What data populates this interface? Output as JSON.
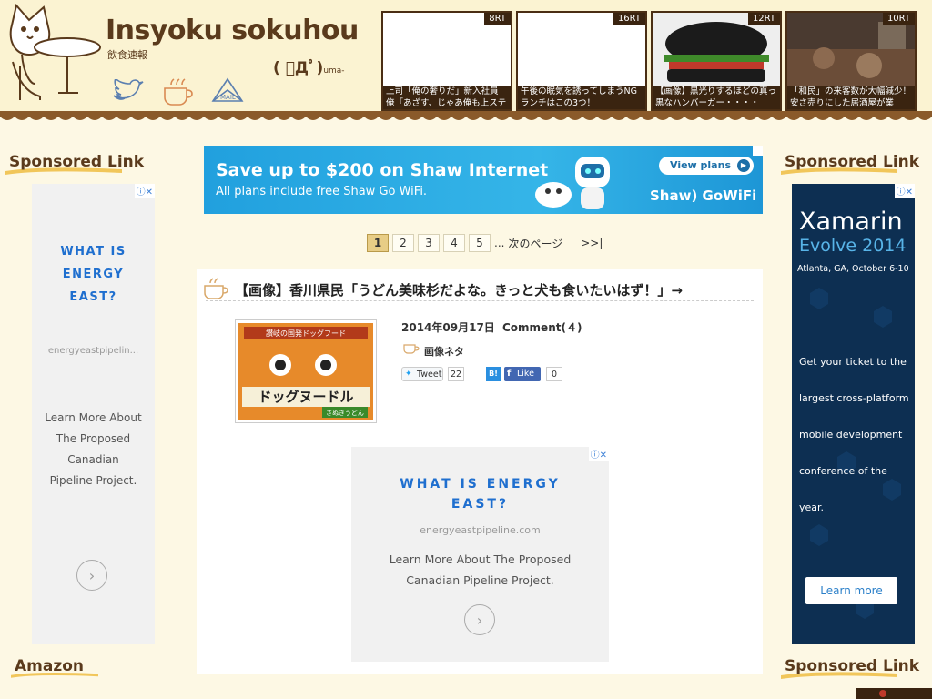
{
  "site": {
    "title": "Insyoku sokuhou",
    "subtitle": "飲食速報",
    "face": "( ﾟДﾟ)",
    "face_suffix": "uma-"
  },
  "social": [
    {
      "name": "twitter-icon"
    },
    {
      "name": "rss-icon"
    },
    {
      "name": "mail-icon"
    }
  ],
  "rt_items": [
    {
      "badge": "8RT",
      "caption": "上司「俺の奢りだ」新入社員 俺「あざす、じゃあ俺も上ステ"
    },
    {
      "badge": "16RT",
      "caption": "午後の眠気を誘ってしまうNG ランチはこの3つ！"
    },
    {
      "badge": "12RT",
      "caption": "【画像】黒光りするほどの真っ 黒なハンバーガー・・・・"
    },
    {
      "badge": "10RT",
      "caption": "「和民」の来客数が大幅減少！ 安さ売りにした居酒屋が業"
    }
  ],
  "left_sidebar": {
    "title": "Sponsored Link",
    "bottom_title": "Amazon",
    "ad": {
      "headline": "WHAT IS ENERGY EAST?",
      "url": "energyeastpipelin...",
      "body": "Learn More About The Proposed Canadian Pipeline Project."
    }
  },
  "right_sidebar": {
    "title": "Sponsored Link",
    "bottom_title": "Sponsored Link",
    "ad": {
      "brand": "Xamarin",
      "event": "Evolve 2014",
      "location": "Atlanta, GA, October 6-10",
      "lines": [
        "Get your ticket to the",
        "largest cross-platform",
        "mobile development",
        "conference of the year."
      ],
      "cta": "Learn more"
    }
  },
  "banner": {
    "headline": "Save up to $200 on Shaw Internet",
    "subline": "All plans include free Shaw Go WiFi.",
    "cta": "View plans",
    "logo": "Shaw) GoWiFi"
  },
  "pager": {
    "pages": [
      "1",
      "2",
      "3",
      "4",
      "5"
    ],
    "active": "1",
    "ellipsis": "...",
    "next": "次のページ",
    "last": ">>|"
  },
  "article": {
    "title": "【画像】香川県民「うどん美味杉だよな。きっと犬も食いたいはず！」→",
    "date": "2014年09月17日",
    "comment": "Comment(４)",
    "category": "画像ネタ",
    "thumb_label_top": "讃岐の国発ドッグフード",
    "thumb_label_main": "ドッグヌードル",
    "thumb_label_sub": "さぬきうどん",
    "tweet": "Tweet",
    "tweet_count": "22",
    "hatena": "B!",
    "fb_like": "Like",
    "fb_count": "0",
    "ad": {
      "headline": "WHAT IS ENERGY EAST?",
      "url": "energyeastpipeline.com",
      "body": "Learn More About The Proposed Canadian Pipeline Project."
    }
  },
  "colors": {
    "page_bg": "#fdf8e4",
    "brown": "#5a3a1c",
    "dark_brown": "#3a2410",
    "shaw_blue": "#21a0de",
    "xamarin_navy": "#0d2f52",
    "ad_blue": "#1f6fcf"
  }
}
